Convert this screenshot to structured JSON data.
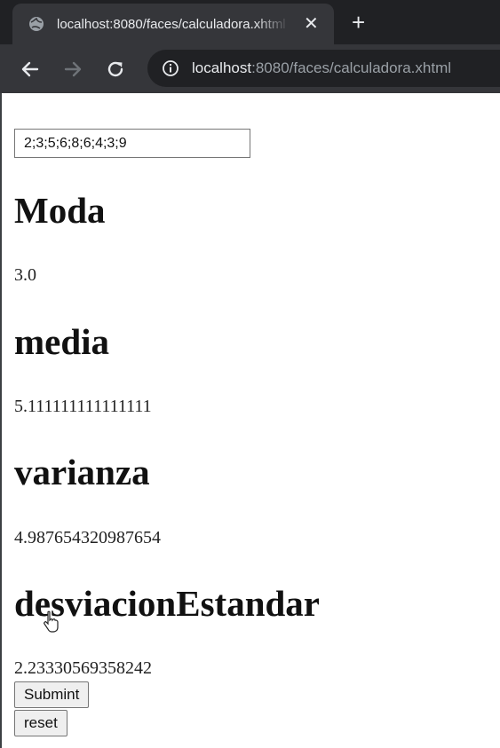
{
  "browser": {
    "tab_title": "localhost:8080/faces/calculadora.xhtml",
    "tab_close": "✕",
    "new_tab": "+",
    "url_host": "localhost",
    "url_path": ":8080/faces/calculadora.xhtml"
  },
  "form": {
    "input_value": "2;3;5;6;8;6;4;3;9"
  },
  "results": {
    "moda_label": "Moda",
    "moda_value": "3.0",
    "media_label": "media",
    "media_value": "5.111111111111111",
    "varianza_label": "varianza",
    "varianza_value": "4.987654320987654",
    "desviacion_label": "desviacionEstandar",
    "desviacion_value": "2.23330569358242"
  },
  "buttons": {
    "submit_label": "Submint",
    "reset_label": "reset"
  },
  "icons": {
    "favicon": "globe-icon",
    "back": "back-arrow-icon",
    "forward": "forward-arrow-icon",
    "reload": "reload-icon",
    "info": "info-icon",
    "cursor": "mouse-cursor-icon"
  },
  "colors": {
    "chrome_dark": "#202124",
    "chrome_tab": "#35363a",
    "chrome_text": "#e8eaed",
    "url_path": "#9aa0a6"
  }
}
